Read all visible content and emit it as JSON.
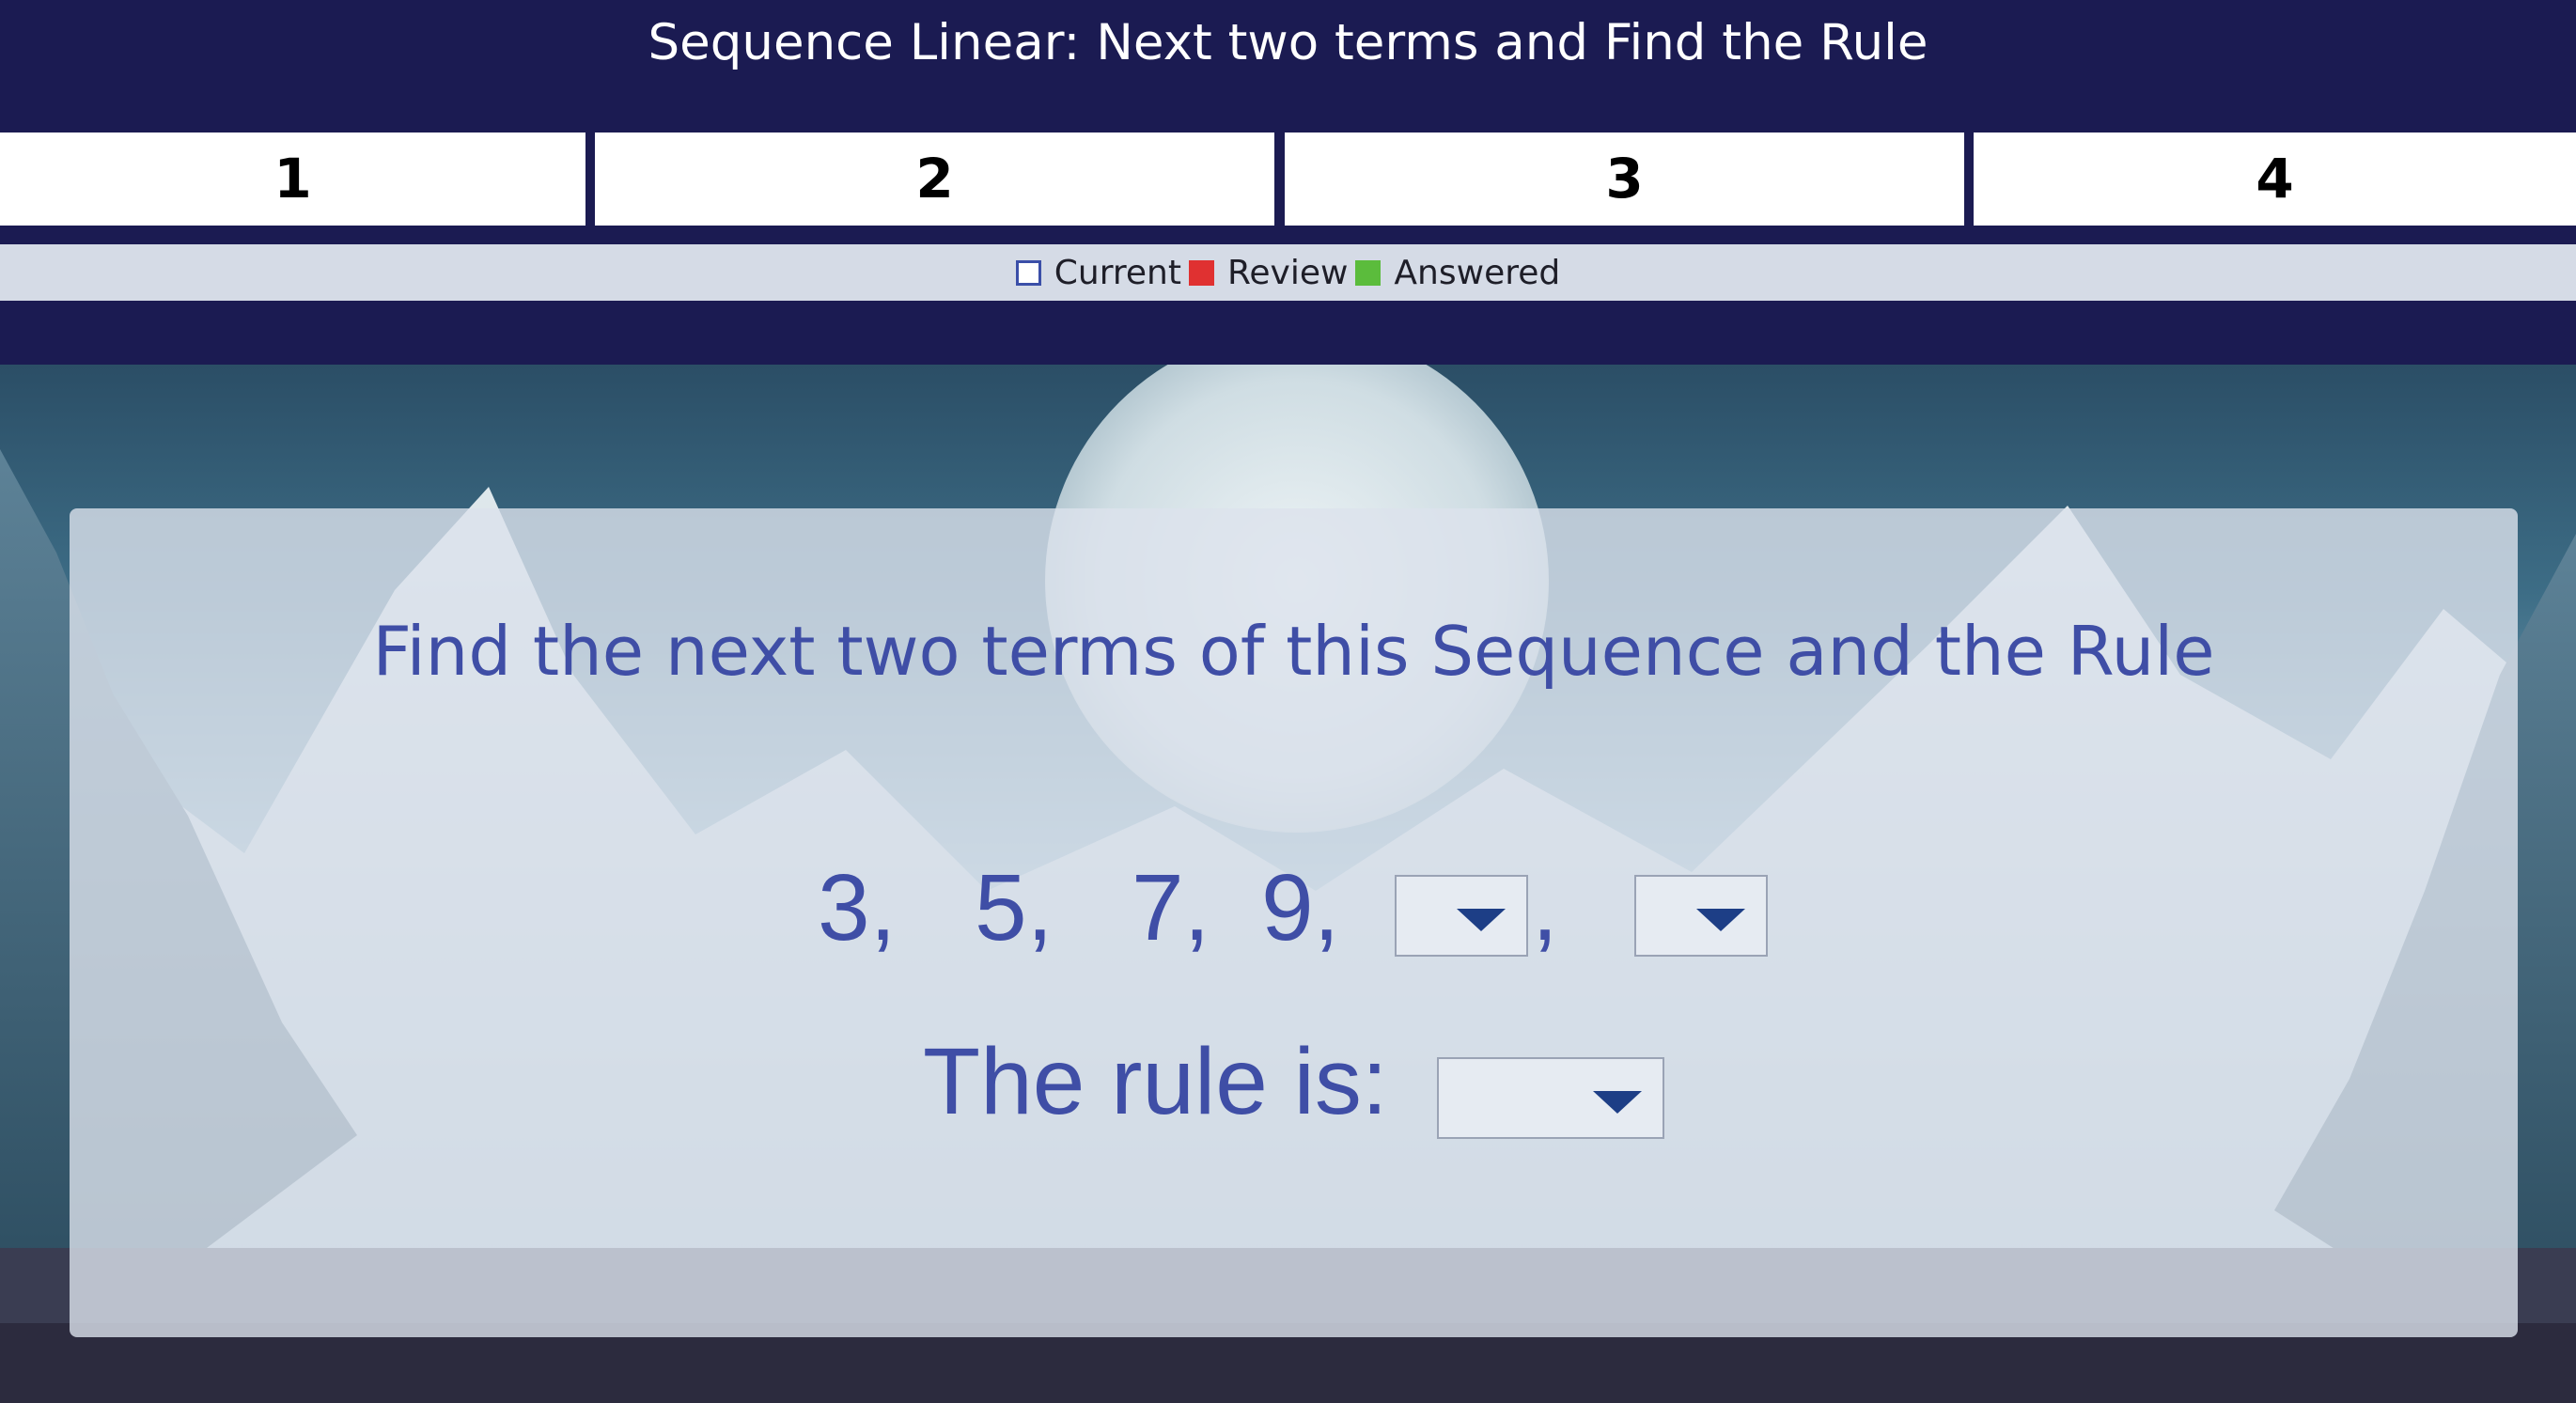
{
  "header": {
    "title": "Sequence Linear: Next two terms and Find the Rule"
  },
  "tabs": [
    {
      "label": "1"
    },
    {
      "label": "2"
    },
    {
      "label": "3"
    },
    {
      "label": "4"
    }
  ],
  "legend": {
    "current": "Current",
    "review": "Review",
    "answered": "Answered",
    "colors": {
      "current": "#ffffff",
      "review": "#e03131",
      "answered": "#5bbc3c"
    }
  },
  "question": {
    "prompt": "Find the next two terms of this Sequence and the Rule",
    "terms": [
      "3,",
      "5,",
      "7,",
      "9,"
    ],
    "separator": ",",
    "rule_label": "The rule is:"
  },
  "colors": {
    "nav": "#1b1b52",
    "text_accent": "#3f4ea6",
    "arrow": "#1d3e86"
  }
}
